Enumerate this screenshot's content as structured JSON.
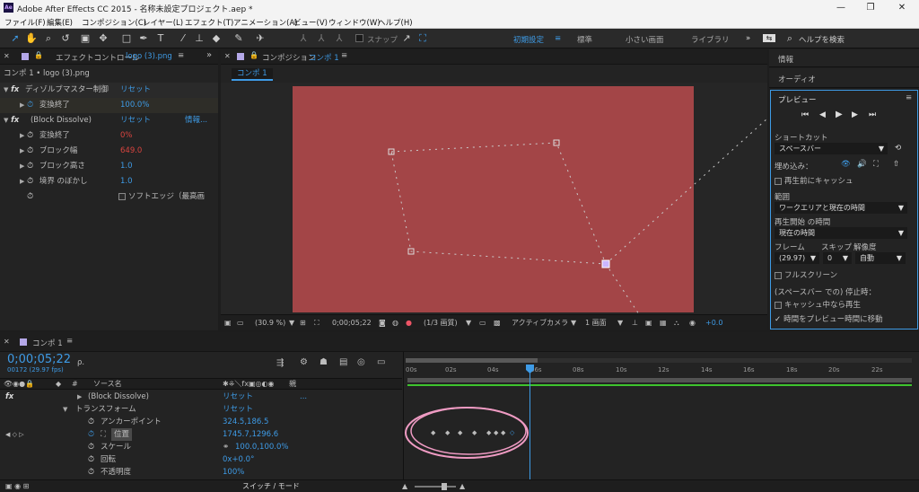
{
  "window": {
    "title": "Adobe After Effects CC 2015 - 名称未設定プロジェクト.aep *",
    "app_icon": "Ae",
    "minimize": "—",
    "maximize": "❐",
    "close": "✕"
  },
  "menu": [
    "ファイル(F)",
    "編集(E)",
    "コンポジション(C)",
    "レイヤー(L)",
    "エフェクト(T)",
    "アニメーション(A)",
    "ビュー(V)",
    "ウィンドウ(W)",
    "ヘルプ(H)"
  ],
  "toolbar": {
    "snap_label": "スナップ",
    "workspaces": [
      "初期設定",
      "標準",
      "小さい画面",
      "ライブラリ"
    ],
    "help_search": "ヘルプを検索",
    "ws_menu": "≡",
    "ws_more": "»"
  },
  "effect_panel": {
    "tab": "エフェクトコントロール",
    "tab_file": "logo (3).png",
    "path": "コンポ 1 • logo (3).png",
    "menu": "≡",
    "more": "»",
    "rows": [
      {
        "label": "ディゾルブマスター制御",
        "reset": "リセット",
        "fx": "fx"
      },
      {
        "label": "変換終了",
        "value": "100.0%"
      },
      {
        "label": "(Block Dissolve)",
        "reset": "リセット",
        "info": "情報...",
        "fx": "fx"
      },
      {
        "label": "変換終了",
        "value": "0%"
      },
      {
        "label": "ブロック幅",
        "value": "649.0"
      },
      {
        "label": "ブロック高さ",
        "value": "1.0"
      },
      {
        "label": "境界 のぼかし",
        "value": "1.0"
      },
      {
        "label": "ソフトエッジ（最高画"
      }
    ]
  },
  "comp_panel": {
    "tab": "コンポジション",
    "tab_name": "コンポ 1",
    "menu": "≡",
    "sub_tab": "コンポ 1",
    "footer": {
      "zoom": "(30.9 %)",
      "timecode": "0;00;05;22",
      "resolution": "(1/3 画質)",
      "camera": "アクティブカメラ",
      "views": "1 画面",
      "exposure": "+0.0"
    }
  },
  "right_panel": {
    "info": "情報",
    "audio": "オーディオ",
    "preview_title": "プレビュー",
    "preview_menu": "≡",
    "shortcut_label": "ショートカット",
    "shortcut_value": "スペースバー",
    "include_label": "埋め込み：",
    "cache_before": "再生前にキャッシュ",
    "range_label": "範囲",
    "range_value": "ワークエリアと現在の時間",
    "play_from_label": "再生開始 の時間",
    "play_from_value": "現在の時間",
    "frame_label": "フレーム",
    "skip_label": "スキップ",
    "res_label": "解像度",
    "frame_value": "(29.97)",
    "skip_value": "0",
    "res_value": "自動",
    "fullscreen": "フルスクリーン",
    "stop_label": "(スペースバー での) 停止時：",
    "cache_while": "キャッシュ中なら再生",
    "move_time": "時間をプレビュー時間に移動"
  },
  "timeline": {
    "tab": "コンポ 1",
    "menu": "≡",
    "timecode": "0;00;05;22",
    "fps": "00172 (29.97 fps)",
    "search_placeholder": "ρ.",
    "source_name": "ソース名",
    "parent_header": "親",
    "switch_mode": "スイッチ / モード",
    "hash": "#",
    "ruler": [
      "00s",
      "02s",
      "04s",
      "06s",
      "08s",
      "10s",
      "12s",
      "14s",
      "16s",
      "18s",
      "20s",
      "22s"
    ],
    "layers": [
      {
        "name": "(Block Dissolve)",
        "value": "リセット",
        "extra": "..."
      },
      {
        "name": "トランスフォーム",
        "value": "リセット"
      },
      {
        "name": "アンカーポイント",
        "value": "324.5,186.5"
      },
      {
        "name": "位置",
        "value": "1745.7,1296.6"
      },
      {
        "name": "スケール",
        "value": "100.0,100.0%"
      },
      {
        "name": "回転",
        "value": "0x+0.0°"
      },
      {
        "name": "不透明度",
        "value": "100%"
      }
    ]
  },
  "colors": {
    "accent": "#3e9be6",
    "canvas": "#a34547",
    "annotation": "#ef9bc3"
  }
}
